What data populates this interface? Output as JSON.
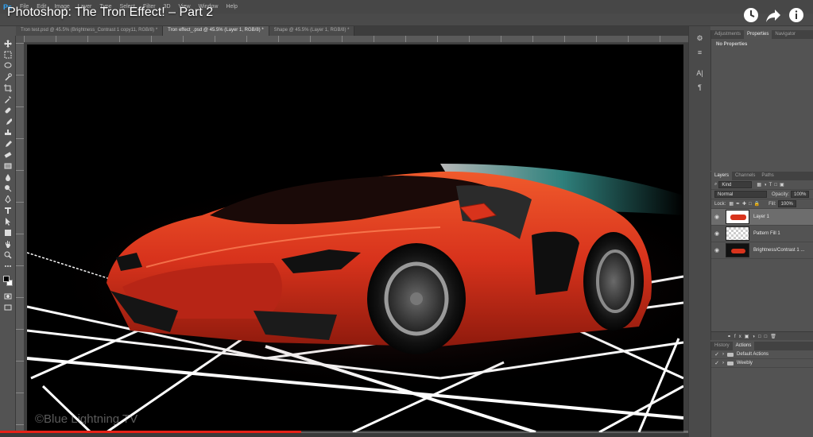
{
  "app": {
    "logo": "Ps"
  },
  "menu": [
    "File",
    "Edit",
    "Image",
    "Layer",
    "Type",
    "Select",
    "Filter",
    "3D",
    "View",
    "Window",
    "Help"
  ],
  "video": {
    "title": "Photoshop: The Tron Effect! – Part 2",
    "watermark": "©Blue Lightning TV",
    "progress": 0.37
  },
  "tabs": [
    {
      "label": "Tron test.psd @ 45.5% (Brightness_Contrast 1 copy11, RGB/8) *",
      "active": false
    },
    {
      "label": "Tron effect_.psd @ 45.5% (Layer 1, RGB/8) *",
      "active": true
    },
    {
      "label": "Shape @ 45.5% (Layer 1, RGB/8) *",
      "active": false
    }
  ],
  "properties_panel": {
    "tabs": [
      "Adjustments",
      "Properties",
      "Navigator"
    ],
    "active_tab": "Properties",
    "body": "No Properties"
  },
  "layers_panel": {
    "tabs": [
      "Layers",
      "Channels",
      "Paths"
    ],
    "filter": "Kind",
    "blend_mode": "Normal",
    "opacity_label": "Opacity:",
    "opacity": "100%",
    "lock_label": "Lock:",
    "fill_label": "Fill:",
    "fill": "100%",
    "layers": [
      {
        "name": "Layer 1",
        "selected": true
      },
      {
        "name": "Pattern Fill 1",
        "selected": false
      },
      {
        "name": "Brightness/Contrast 1 ...",
        "selected": false
      }
    ]
  },
  "history_panel": {
    "tabs": [
      "History",
      "Actions"
    ],
    "active_tab": "Actions",
    "items": [
      "Default Actions",
      "Weebly"
    ]
  },
  "colors": {
    "accent": "#e62117",
    "car_red": "#d8331c",
    "streak": "#4fd6cf"
  }
}
